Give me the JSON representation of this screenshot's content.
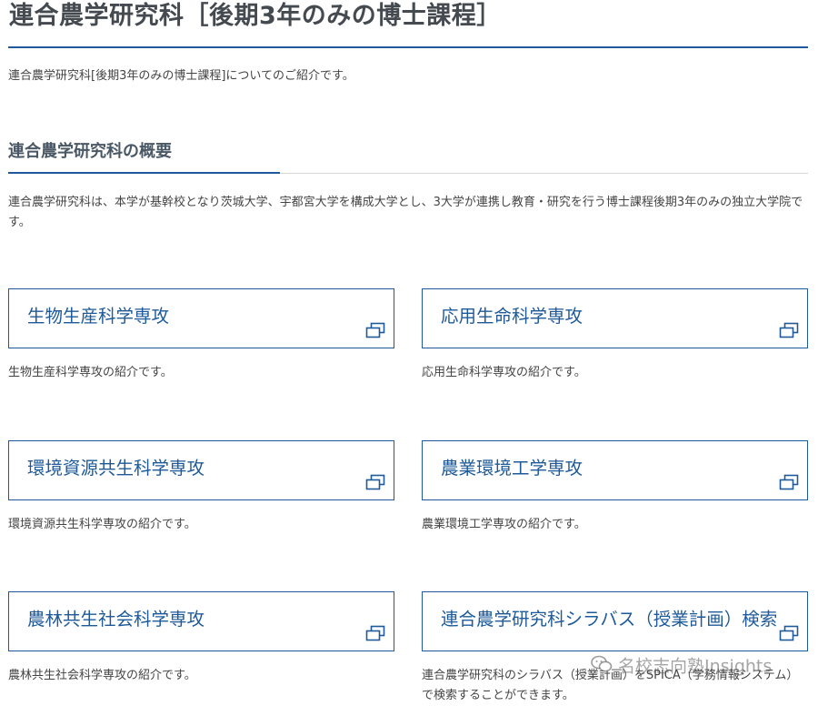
{
  "page": {
    "title": "連合農学研究科［後期3年のみの博士課程］",
    "intro": "連合農学研究科[後期3年のみの博士課程]についてのご紹介です。"
  },
  "section": {
    "heading": "連合農学研究科の概要",
    "overview": "連合農学研究科は、本学が基幹校となり茨城大学、宇都宮大学を構成大学とし、3大学が連携し教育・研究を行う博士課程後期3年のみの独立大学院です。"
  },
  "cards": [
    {
      "label": "生物生産科学専攻",
      "description": "生物生産科学専攻の紹介です。",
      "icon": "external-window-icon"
    },
    {
      "label": "応用生命科学専攻",
      "description": "応用生命科学専攻の紹介です。",
      "icon": "external-window-icon"
    },
    {
      "label": "環境資源共生科学専攻",
      "description": "環境資源共生科学専攻の紹介です。",
      "icon": "external-window-icon"
    },
    {
      "label": "農業環境工学専攻",
      "description": "農業環境工学専攻の紹介です。",
      "icon": "external-window-icon"
    },
    {
      "label": "農林共生社会科学専攻",
      "description": "農林共生社会科学専攻の紹介です。",
      "icon": "external-window-icon"
    },
    {
      "label": "連合農学研究科シラバス（授業計画）検索",
      "description": "連合農学研究科のシラバス（授業計画）をSPICA（学務情報システム）で検索することができます。",
      "icon": "external-window-icon"
    }
  ],
  "watermark": {
    "text": "名校志向塾Insights",
    "icon": "wechat-icon"
  },
  "colors": {
    "accent": "#1e5a9a",
    "heading": "#444a50",
    "body_text": "#444444",
    "rule_gray": "#d6d6d6"
  }
}
